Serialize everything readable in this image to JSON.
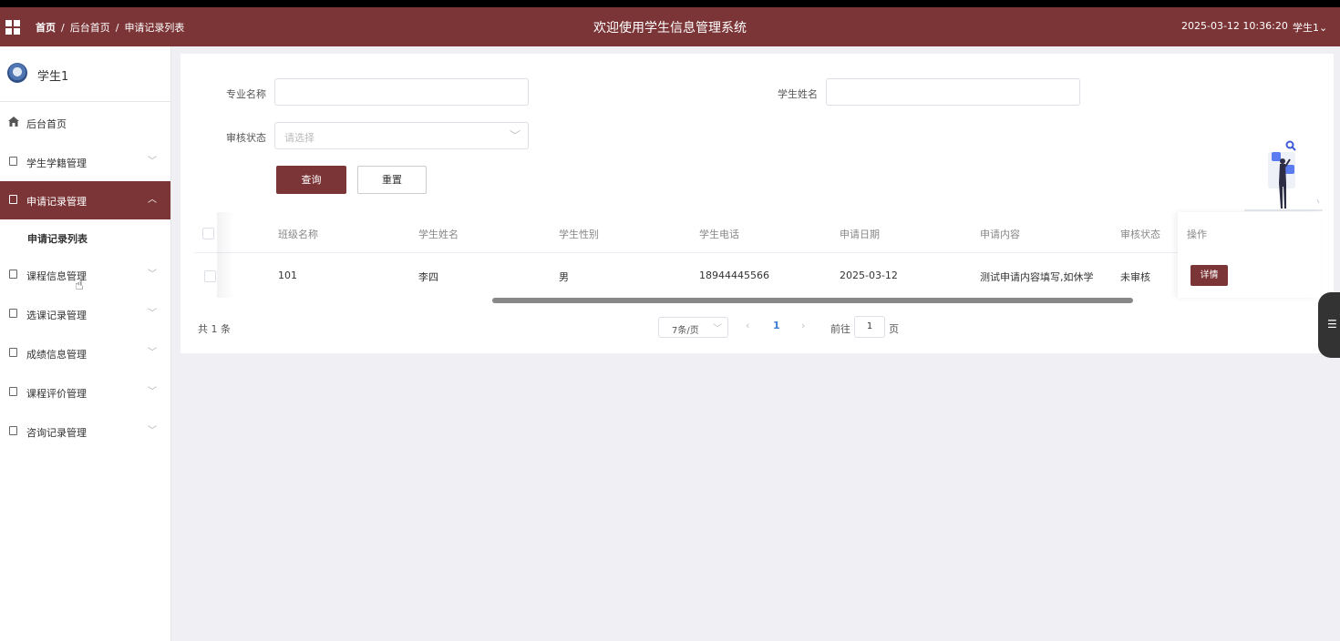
{
  "header": {
    "breadcrumb": [
      "首页",
      "后台首页",
      "申请记录列表"
    ],
    "breadcrumb_separator": "/",
    "title": "欢迎使用学生信息管理系统",
    "datetime": "2025-03-12 10:36:20",
    "user": "学生1⌄",
    "color": "#7b3537"
  },
  "sidebar": {
    "user_name": "学生1",
    "items": [
      {
        "label": "后台首页",
        "icon": "home-icon"
      },
      {
        "label": "学生学籍管理",
        "icon": "folder-icon",
        "expanded": false
      },
      {
        "label": "申请记录管理",
        "icon": "folder-icon",
        "expanded": true,
        "active": true
      },
      {
        "label": "课程信息管理",
        "icon": "folder-icon",
        "expanded": false
      },
      {
        "label": "选课记录管理",
        "icon": "folder-icon",
        "expanded": false
      },
      {
        "label": "成绩信息管理",
        "icon": "folder-icon",
        "expanded": false
      },
      {
        "label": "课程评价管理",
        "icon": "folder-icon",
        "expanded": false
      },
      {
        "label": "咨询记录管理",
        "icon": "folder-icon",
        "expanded": false
      }
    ],
    "submenu": {
      "label": "申请记录列表"
    }
  },
  "filters": {
    "major_label": "专业名称",
    "major_value": "",
    "student_label": "学生姓名",
    "student_value": "",
    "status_label": "审核状态",
    "status_placeholder": "请选择",
    "query_button": "查询",
    "reset_button": "重置"
  },
  "table": {
    "columns": [
      "班级名称",
      "学生姓名",
      "学生性别",
      "学生电话",
      "申请日期",
      "申请内容",
      "审核状态",
      "操作"
    ],
    "rows": [
      {
        "class": "101",
        "name": "李四",
        "gender": "男",
        "phone": "18944445566",
        "date": "2025-03-12",
        "content": "测试申请内容填写,如休学",
        "status": "未审核",
        "action": "详情"
      }
    ]
  },
  "pagination": {
    "total_text": "共 1 条",
    "page_size": "7条/页",
    "current_page": "1",
    "goto_label": "前往",
    "goto_value": "1",
    "page_unit": "页"
  }
}
